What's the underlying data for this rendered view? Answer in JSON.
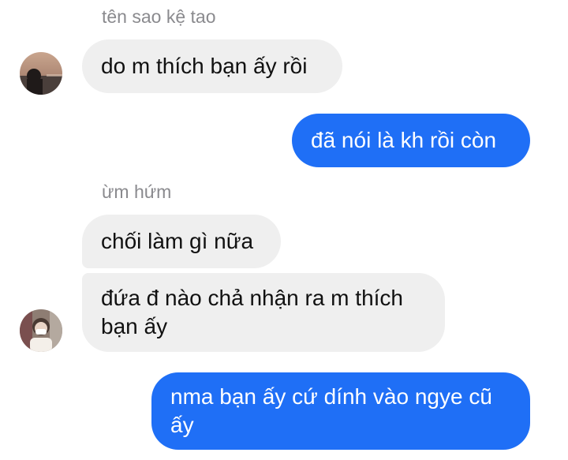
{
  "conversation": {
    "groups": [
      {
        "sender_name": "tên sao kệ tao",
        "messages": [
          "do m thích bạn ấy rồi"
        ]
      },
      {
        "sender_name": "",
        "messages": [
          "đã nói là kh rồi còn"
        ]
      },
      {
        "sender_name": "ừm hứm",
        "messages": [
          "chối làm gì nữa",
          "đứa đ nào chả nhận ra m thích bạn ấy"
        ]
      },
      {
        "sender_name": "",
        "messages": [
          "nma bạn ấy cứ dính vào ngye cũ ấy"
        ]
      }
    ]
  },
  "colors": {
    "incoming_bubble": "#efefef",
    "outgoing_bubble": "#1f6ff6",
    "sender_name_text": "#8a8a8e"
  },
  "icons": {
    "avatar_1": "contact-avatar-photo-sunset",
    "avatar_2": "contact-avatar-photo-person-mask"
  }
}
